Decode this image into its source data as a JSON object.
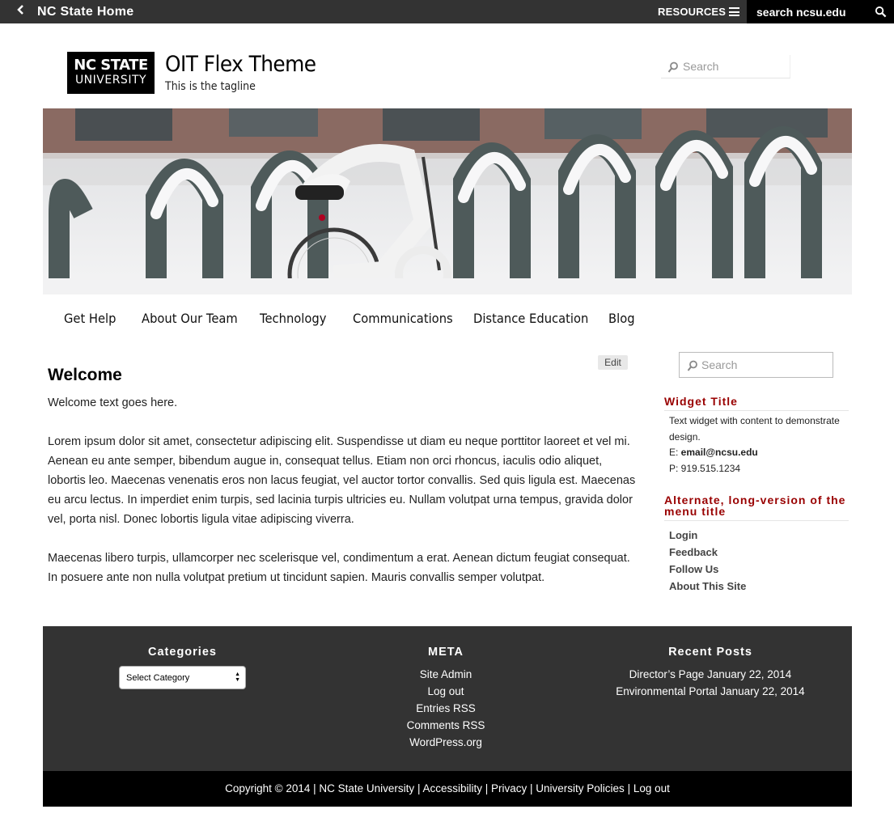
{
  "topbar": {
    "home_label": "NC State Home",
    "resources_label": "RESOURCES",
    "search_placeholder": "search ncsu.edu"
  },
  "header": {
    "logo_line1": "NC STATE",
    "logo_line2": "UNIVERSITY",
    "site_title": "OIT Flex Theme",
    "tagline": "This is the tagline",
    "search_placeholder": "Search"
  },
  "nav": {
    "items": [
      {
        "label": "Get Help"
      },
      {
        "label": "About Our Team"
      },
      {
        "label": "Technology"
      },
      {
        "label": "Communications"
      },
      {
        "label": "Distance Education"
      },
      {
        "label": "Blog"
      }
    ]
  },
  "main": {
    "edit_label": "Edit",
    "title": "Welcome",
    "paragraphs": [
      "Welcome text goes here.",
      "Lorem ipsum dolor sit amet, consectetur adipiscing elit. Suspendisse ut diam eu neque porttitor laoreet et vel mi. Aenean eu ante semper, bibendum augue in, consequat tellus. Etiam non orci rhoncus, iaculis odio aliquet, lobortis leo. Maecenas venenatis eros non lacus feugiat, vel auctor tortor convallis. Sed quis ligula est. Maecenas eu arcu lectus. In imperdiet enim turpis, sed lacinia turpis ultricies eu. Nullam volutpat urna tempus, gravida dolor vel, porta nisl. Donec lobortis ligula vitae adipiscing viverra.",
      "Maecenas libero turpis, ullamcorper nec scelerisque vel, condimentum a erat. Aenean dictum feugiat consequat. In posuere ante non nulla volutpat pretium ut tincidunt sapien. Mauris convallis semper volutpat."
    ]
  },
  "sidebar": {
    "search_placeholder": "Search",
    "widget1": {
      "title": "Widget Title",
      "text": "Text widget with content to demonstrate design.",
      "email_prefix": "E: ",
      "email": "email@ncsu.edu",
      "phone": "P: 919.515.1234"
    },
    "widget2": {
      "title": "Alternate, long-version of the menu title",
      "items": [
        "Login",
        "Feedback",
        "Follow Us",
        "About This Site"
      ]
    }
  },
  "footer": {
    "categories_title": "Categories",
    "category_select": "Select Category",
    "meta_title": "META",
    "meta_items": [
      "Site Admin",
      "Log out",
      "Entries RSS",
      "Comments RSS",
      "WordPress.org"
    ],
    "recent_title": "Recent Posts",
    "recent_posts": [
      {
        "title": "Director’s Page",
        "date": "January 22, 2014"
      },
      {
        "title": "Environmental Portal",
        "date": "January 22, 2014"
      }
    ],
    "copyright": {
      "text": "Copyright © 2014",
      "links": [
        "NC State University",
        "Accessibility",
        "Privacy",
        "University Policies",
        "Log out"
      ],
      "separator": " | "
    }
  },
  "colors": {
    "topbar_bg": "#333333",
    "accent_red": "#990000",
    "footer_bg": "#333333",
    "copyright_bg": "#000000"
  }
}
